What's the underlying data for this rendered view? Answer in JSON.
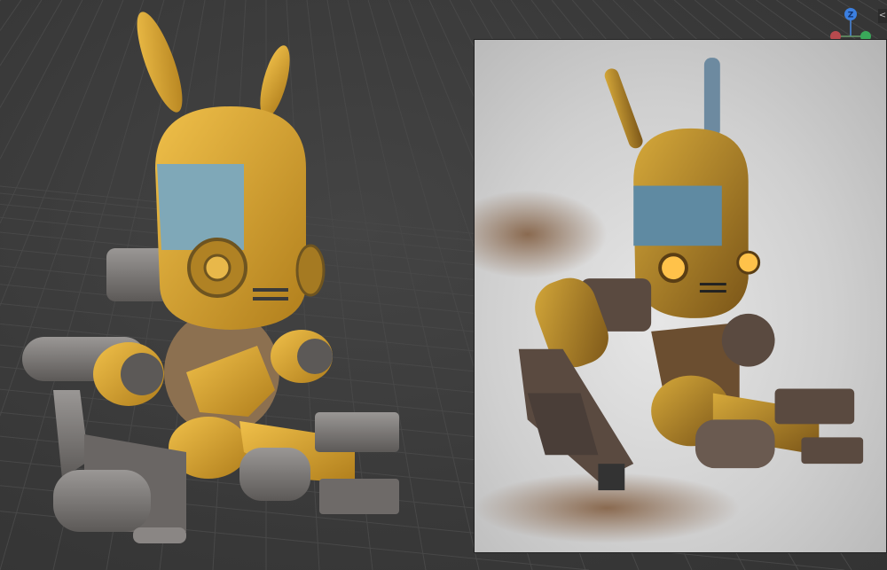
{
  "viewport": {
    "gizmo": {
      "axis_label": "Z",
      "icon": "orientation-gizmo-icon"
    },
    "collapse_icon": "chevron-left-icon",
    "collapse_label": "<"
  },
  "colors": {
    "background": "#3a3a3a",
    "grid": "#4a4a4a",
    "model_yellow": "#d9a22e",
    "model_blue": "#7fa8b8",
    "model_grey": "#7d7a78",
    "gizmo_z": "#3b7fe0",
    "gizmo_x": "#c0454a",
    "gizmo_y": "#3aa85a"
  }
}
